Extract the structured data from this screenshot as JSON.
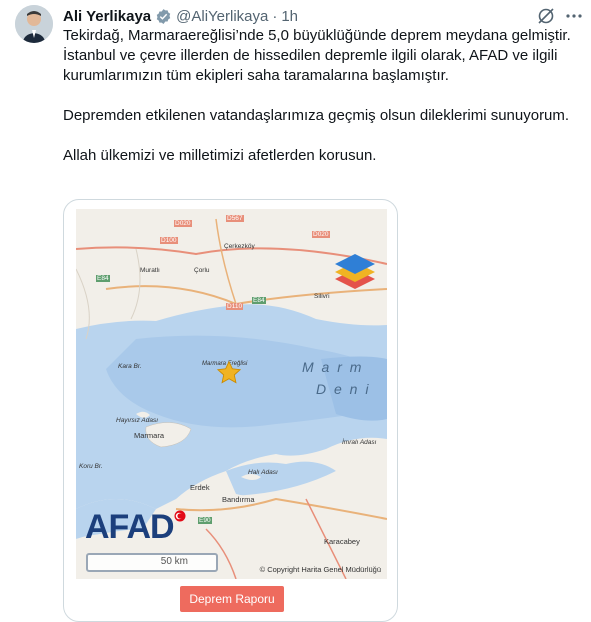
{
  "tweet": {
    "author_name": "Ali Yerlikaya",
    "author_handle": "@AliYerlikaya",
    "separator": "·",
    "timestamp": "1h",
    "paragraphs": [
      "Tekirdağ, Marmaraereğlisi’nde 5,0 büyüklüğünde deprem meydana gelmiştir. İstanbul ve çevre illerden de hissedilen depremle ilgili olarak, AFAD ve ilgili kurumlarımızın tüm ekipleri saha taramalarına başlamıştır.",
      "Depremden etkilenen vatandaşlarımıza geçmiş olsun dileklerimi sunuyorum.",
      "Allah ülkemizi ve milletimizi afetlerden korusun."
    ]
  },
  "card": {
    "logo_text": "AFAD",
    "scale_label": "50 km",
    "copyright": "© Copyright Harita Genel Müdürlüğü",
    "button_label": "Deprem Raporu",
    "map_labels": {
      "cerkezkoy": "Çerkezköy",
      "corlu": "Çorlu",
      "muratli": "Muratlı",
      "silivri": "Silivri",
      "marmaraereglisi": "Marmara Ereğlisi",
      "kara_br": "Kara Br.",
      "hayirsiz_adasi": "Hayırsız Adası",
      "marmara": "Marmara",
      "koru_br": "Koru Br.",
      "hali_adasi": "Halı Adası",
      "imrali_adasi": "İmralı Adası",
      "erdek": "Erdek",
      "bandirma": "Bandırma",
      "karacabey": "Karacabey",
      "sea_1": "M a r m",
      "sea_2": "D e n i",
      "road_d020": "D020",
      "road_d567": "D567",
      "road_d100": "D100",
      "road_d110": "D110",
      "road_e84": "E84",
      "road_e80": "E80",
      "road_e90": "E90",
      "road_d200": "D200"
    }
  },
  "colors": {
    "brand_afad": "#1c3f7c",
    "button_bg": "#ee6b5e",
    "verified_blue": "#1d9bf0",
    "sea": "#b9d4ee",
    "land": "#f2efe9"
  },
  "icons": [
    "verified-badge-icon",
    "grok-icon",
    "more-icon",
    "earthquake-star-icon",
    "layers-icon",
    "turkish-flag-icon"
  ]
}
